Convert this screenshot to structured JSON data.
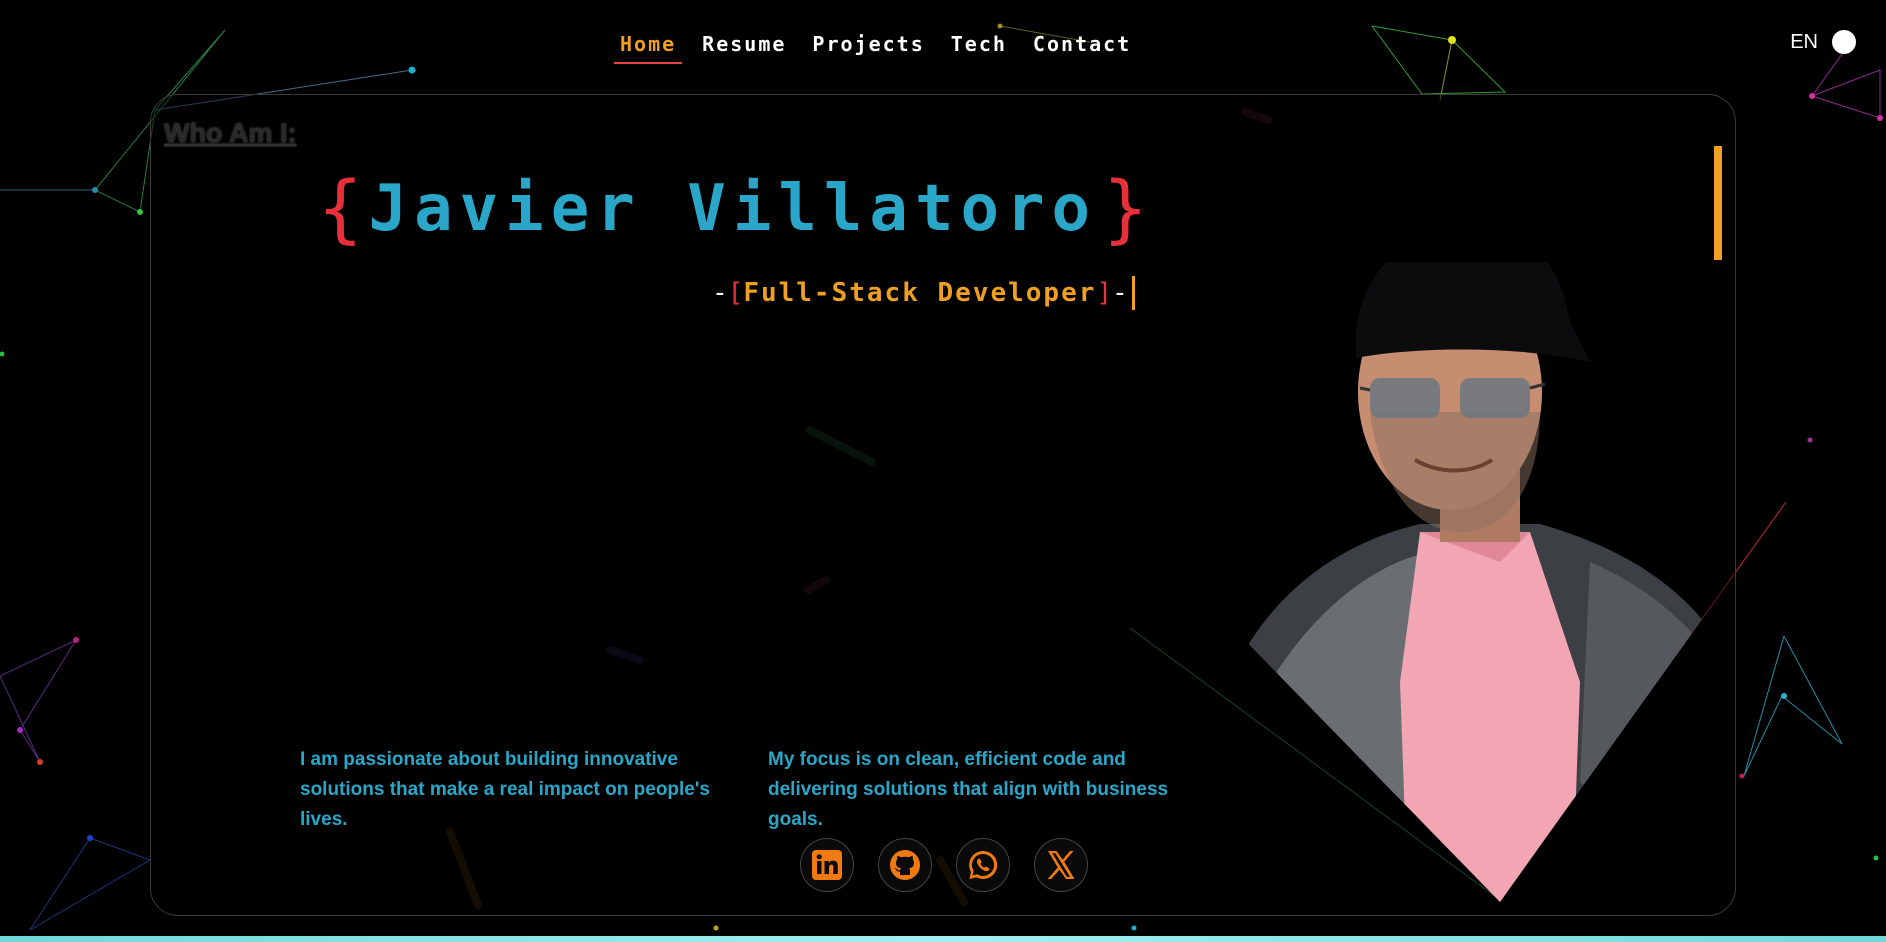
{
  "nav": {
    "items": [
      {
        "label": "Home",
        "active": true
      },
      {
        "label": "Resume",
        "active": false
      },
      {
        "label": "Projects",
        "active": false
      },
      {
        "label": "Tech",
        "active": false
      },
      {
        "label": "Contact",
        "active": false
      }
    ]
  },
  "lang": {
    "label": "EN"
  },
  "hero": {
    "section_tag": "Who Am I:",
    "brace_open": "{",
    "name": "Javier Villatoro",
    "brace_close": "}",
    "role_prefix": "-",
    "role_bracket_open": "[",
    "role": "Full-Stack Developer",
    "role_bracket_close": "]",
    "role_suffix": "-"
  },
  "about": {
    "p1": "I am passionate about building innovative solutions that make a real impact on people's lives.",
    "p2": "My focus is on clean, efficient code and delivering solutions that align with business goals."
  },
  "socials": [
    {
      "icon": "linkedin-icon"
    },
    {
      "icon": "github-icon"
    },
    {
      "icon": "whatsapp-icon"
    },
    {
      "icon": "x-icon"
    }
  ],
  "colors": {
    "accent": "#f0a020",
    "name": "#2aa6c8",
    "brace": "#e8303a",
    "social_icon": "#f07a10"
  }
}
